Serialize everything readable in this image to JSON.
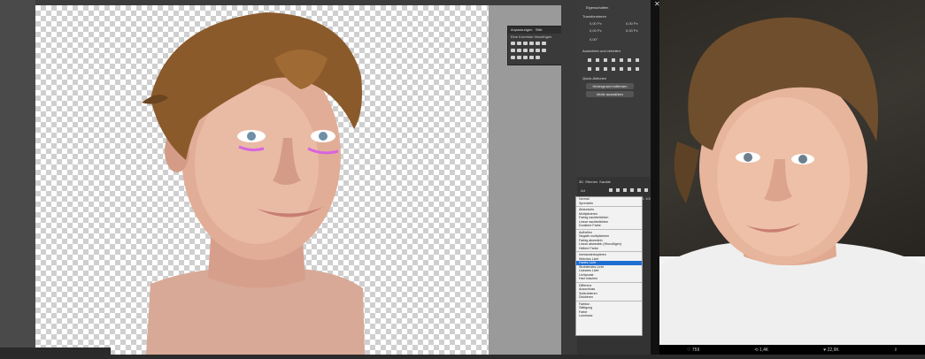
{
  "photoshop": {
    "float_panel": {
      "tabs": [
        "Anpassungen",
        "Stile"
      ],
      "caption": "Eine Korrektur hinzufügen"
    },
    "properties": {
      "tab": "Eigenschaften",
      "section": "Transformieren",
      "w_value": "0,00 Px",
      "h_value": "0,00 Px",
      "x_value": "0,00 Px",
      "y_value": "0,00 Px",
      "angle_value": "0,00°",
      "align_section": "Ausrichten und verteilen",
      "quick_actions": "Quick-Aktionen",
      "btn_remove_bg": "Hintergrund entfernen",
      "btn_select_subject": "Motiv auswählen"
    },
    "layers": {
      "tabs": [
        "3D",
        "Ebenen",
        "Kanäle"
      ],
      "search_label": "Art",
      "opacity_label": "Deckkraft: 100%",
      "blend_modes": [
        [
          "Normal",
          "Sprenkeln"
        ],
        [
          "Abdunkeln",
          "Multiplizieren",
          "Farbig nachbelichten",
          "Linear nachbelichten",
          "Dunklere Farbe"
        ],
        [
          "Aufhellen",
          "Negativ multiplizieren",
          "Farbig abwedeln",
          "Linear abwedeln (Hinzufügen)",
          "Hellere Farbe"
        ],
        [
          "Ineinanderkopieren",
          "Weiches Licht",
          "Hartes Licht",
          "Strahlendes Licht",
          "Lineares Licht",
          "Lichtpunkt",
          "Hart mischen"
        ],
        [
          "Differenz",
          "Ausschluss",
          "Subtrahieren",
          "Dividieren"
        ],
        [
          "Farbton",
          "Sättigung",
          "Farbe",
          "Luminanz"
        ]
      ],
      "selected_mode": "Hartes Licht"
    }
  },
  "tweet": {
    "replies": "759",
    "retweets": "1,4K",
    "likes": "22,9K"
  },
  "colors": {
    "accent_blue": "#1f6fd1",
    "hair_brown": "#8a5a2b",
    "skin_tone": "#e8b9a4"
  }
}
